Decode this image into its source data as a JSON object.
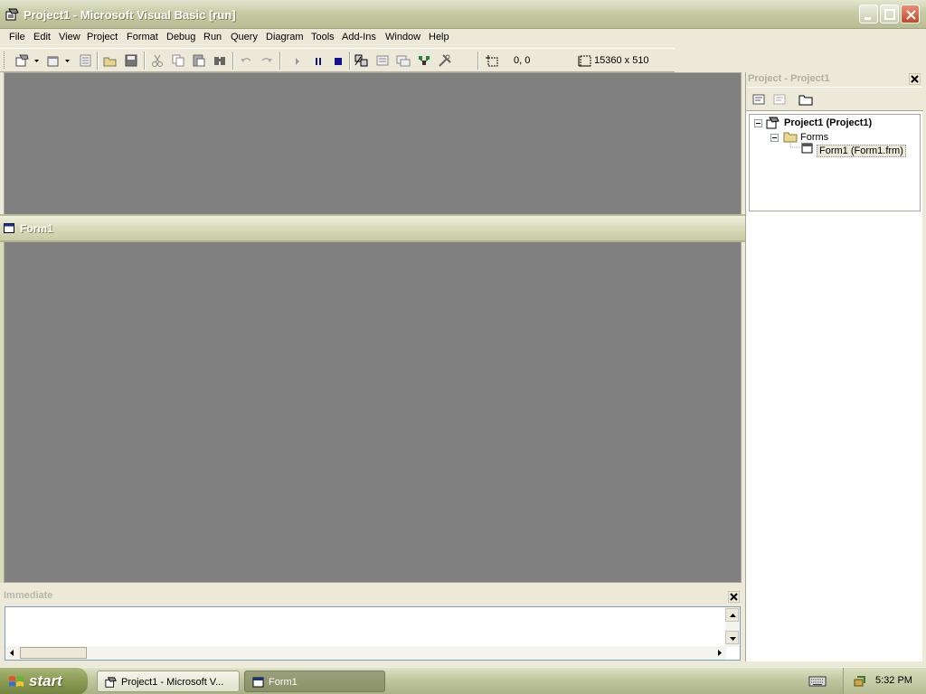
{
  "window": {
    "title": "Project1 - Microsoft Visual Basic [run]"
  },
  "menu": {
    "items": [
      "File",
      "Edit",
      "View",
      "Project",
      "Format",
      "Debug",
      "Run",
      "Query",
      "Diagram",
      "Tools",
      "Add-Ins",
      "Window",
      "Help"
    ]
  },
  "toolbar": {
    "position_readout": "0, 0",
    "size_readout": "15360 x 510",
    "buttons": [
      "add-project",
      "add-form",
      "menu-editor",
      "open-project",
      "save-project",
      "cut",
      "copy",
      "paste",
      "find",
      "undo",
      "redo",
      "start",
      "break",
      "end",
      "project-explorer",
      "properties-window",
      "form-layout",
      "object-browser",
      "toolbox"
    ]
  },
  "form1": {
    "title": "Form1"
  },
  "project_panel": {
    "title": "Project - Project1",
    "tree": {
      "root": "Project1 (Project1)",
      "folder": "Forms",
      "item": "Form1 (Form1.frm)"
    }
  },
  "immediate": {
    "title": "Immediate",
    "content": ""
  },
  "taskbar": {
    "start_label": "start",
    "tasks": [
      "Project1 - Microsoft V...",
      "Form1"
    ],
    "clock": "5:32 PM"
  },
  "colors": {
    "workspace": "#808080",
    "chrome": "#ece9d8",
    "titlebar": "#c6cba4"
  }
}
